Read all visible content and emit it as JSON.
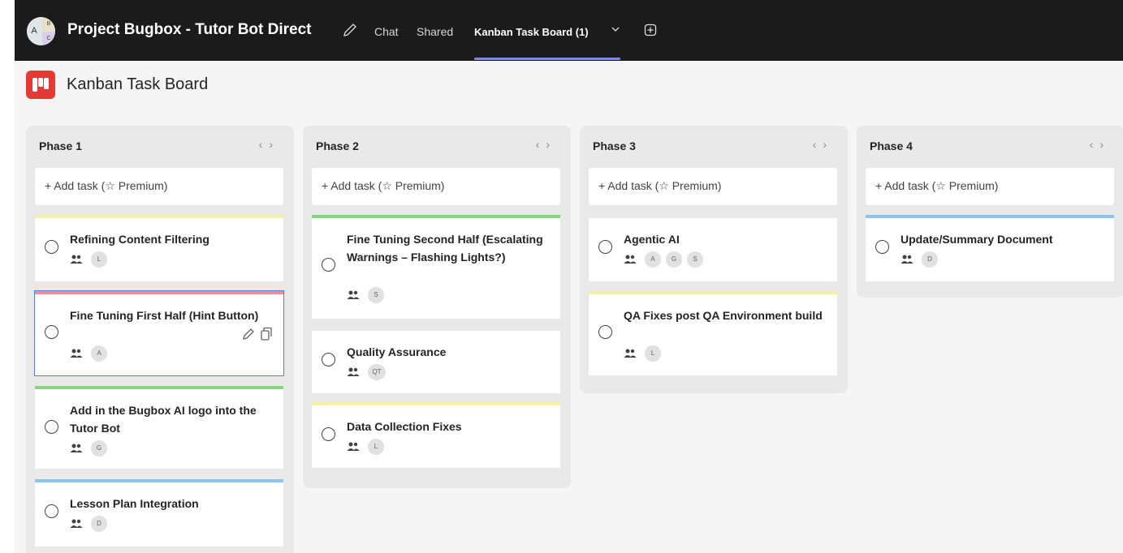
{
  "header": {
    "avatar_initials": [
      "A",
      "B",
      "C"
    ],
    "chat_title": "Project Bugbox - Tutor Bot Direct",
    "tabs": [
      {
        "label": "Chat",
        "active": false
      },
      {
        "label": "Shared",
        "active": false
      },
      {
        "label": "Kanban Task Board (1)",
        "active": true
      }
    ],
    "accent_color": "#7f85f5"
  },
  "app": {
    "title": "Kanban Task Board",
    "logo_color": "#e53935"
  },
  "columns": [
    {
      "name": "Phase 1",
      "add_task_label": "+ Add task (☆ Premium)",
      "cards": [
        {
          "title": "Refining Content Filtering",
          "color": "#f4f1a6",
          "assignees": [
            "L"
          ]
        },
        {
          "title": "Fine Tuning First Half (Hint Button)",
          "color": "#f28b95",
          "assignees": [
            "A"
          ],
          "selected": true
        },
        {
          "title": "Add in the Bugbox AI logo into the Tutor Bot",
          "color": "#84d67a",
          "assignees": [
            "G"
          ]
        },
        {
          "title": "Lesson Plan Integration",
          "color": "#8cc4ee",
          "assignees": [
            "D"
          ]
        }
      ]
    },
    {
      "name": "Phase 2",
      "add_task_label": "+ Add task (☆ Premium)",
      "cards": [
        {
          "title": "Fine Tuning Second Half (Escalating Warnings – Flashing Lights?)",
          "color": "#84d67a",
          "assignees": [
            "S"
          ]
        },
        {
          "title": "Quality Assurance",
          "color": "#e9e9e9",
          "assignees": [
            "QT"
          ]
        },
        {
          "title": "Data Collection Fixes",
          "color": "#f4f1a6",
          "assignees": [
            "L"
          ]
        }
      ]
    },
    {
      "name": "Phase 3",
      "add_task_label": "+ Add task (☆ Premium)",
      "cards": [
        {
          "title": "Agentic AI",
          "color": "#e9e9e9",
          "assignees": [
            "A",
            "G",
            "S"
          ]
        },
        {
          "title": "QA Fixes post QA Environment build",
          "color": "#f4f1a6",
          "assignees": [
            "L"
          ]
        }
      ]
    },
    {
      "name": "Phase 4",
      "add_task_label": "+ Add task (☆ Premium)",
      "cards": [
        {
          "title": "Update/Summary Document",
          "color": "#8cc4ee",
          "assignees": [
            "D"
          ]
        }
      ]
    }
  ]
}
